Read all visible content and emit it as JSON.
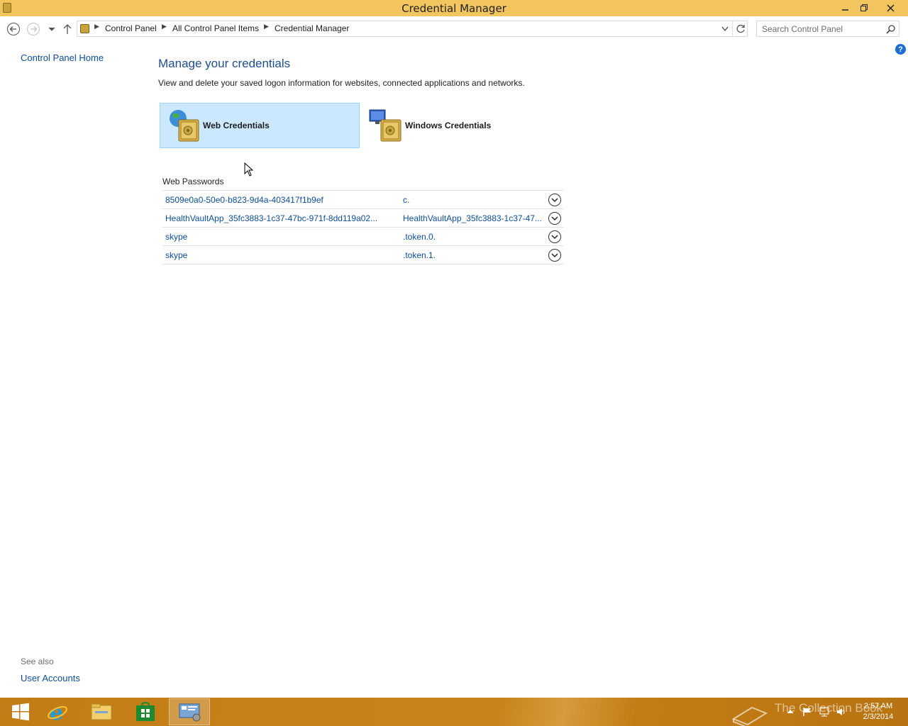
{
  "window": {
    "title": "Credential Manager",
    "min_icon": "minimize-icon",
    "max_icon": "restore-icon",
    "close_icon": "close-icon"
  },
  "address": {
    "crumbs": [
      "Control Panel",
      "All Control Panel Items",
      "Credential Manager"
    ]
  },
  "search": {
    "placeholder": "Search Control Panel"
  },
  "sidebar": {
    "home_link": "Control Panel Home",
    "see_also": "See also",
    "user_accounts": "User Accounts"
  },
  "help": {
    "label": "?"
  },
  "main": {
    "heading": "Manage your credentials",
    "description": "View and delete your saved logon information for websites, connected applications and networks.",
    "tiles": [
      {
        "label": "Web Credentials",
        "selected": true
      },
      {
        "label": "Windows Credentials",
        "selected": false
      }
    ],
    "section_title": "Web Passwords",
    "passwords": [
      {
        "resource": "8509e0a0-50e0-b823-9d4a-403417f1b9ef",
        "user": "c."
      },
      {
        "resource": "HealthVaultApp_35fc3883-1c37-47bc-971f-8dd119a02...",
        "user": "HealthVaultApp_35fc3883-1c37-47..."
      },
      {
        "resource": "skype",
        "user": ".token.0."
      },
      {
        "resource": "skype",
        "user": ".token.1."
      }
    ]
  },
  "taskbar": {
    "watermark": "The Collection Book",
    "time": "2:57 AM",
    "date": "2/3/2014",
    "accent": "#c27c15"
  }
}
